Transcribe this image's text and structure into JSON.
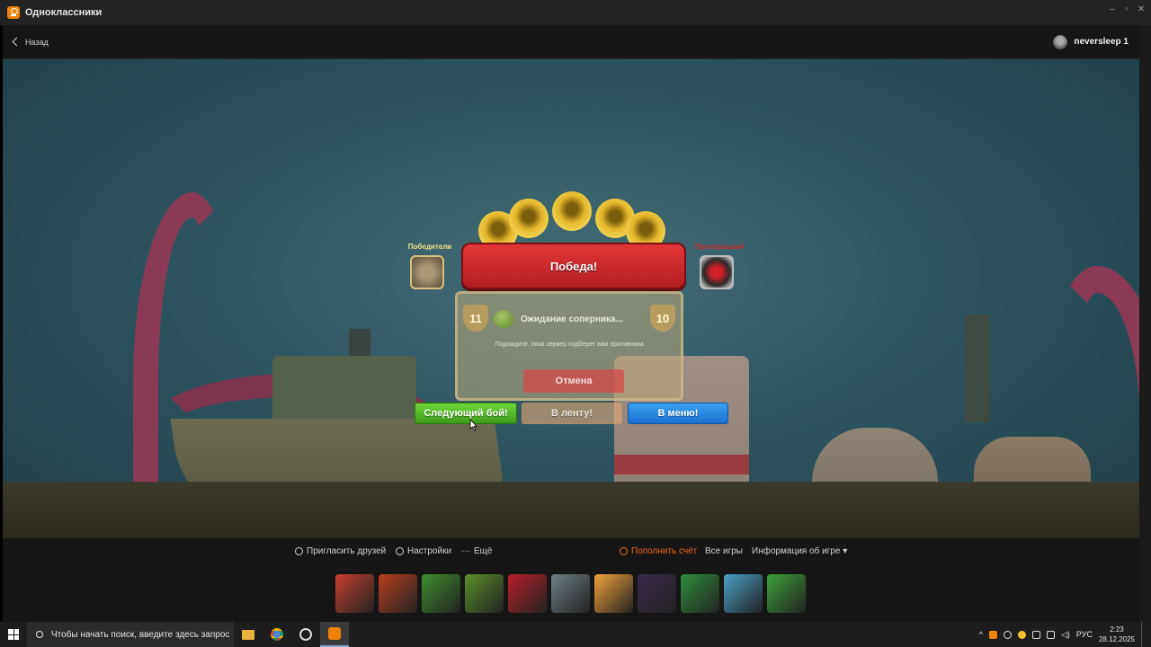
{
  "window": {
    "title": "Одноклассники"
  },
  "header": {
    "back_label": "Назад",
    "username": "neversleep 1"
  },
  "game": {
    "victory": "Победа!",
    "winners_label": "Победители",
    "losers_label": "Проигравший",
    "waiting": {
      "level_left": "11",
      "level_right": "10",
      "title": "Ожидание соперника...",
      "subtitle": "Подождите, пока сервер подберет вам противника",
      "cancel": "Отмена"
    },
    "buttons": {
      "next": "Следующий бой!",
      "feed": "В ленту!",
      "menu": "В меню!"
    }
  },
  "bottom": {
    "invite": "Пригласить друзей",
    "settings": "Настройки",
    "more": "Ещё",
    "topup": "Пополнить счёт",
    "all_games": "Все игры",
    "game_info": "Информация об игре ▾",
    "tiles": [
      {
        "name": "game-tile-1",
        "color": "#c8402f"
      },
      {
        "name": "game-tile-2",
        "color": "#b8401e"
      },
      {
        "name": "game-tile-3",
        "color": "#3f8f2e"
      },
      {
        "name": "game-tile-4",
        "color": "#5c8f2a"
      },
      {
        "name": "game-tile-5",
        "color": "#b9202a"
      },
      {
        "name": "game-tile-6",
        "color": "#6f7f86"
      },
      {
        "name": "game-tile-7",
        "color": "#f2a23a"
      },
      {
        "name": "game-tile-8",
        "color": "#3a2a4a"
      },
      {
        "name": "game-tile-9",
        "color": "#2f8f3a"
      },
      {
        "name": "game-tile-10",
        "color": "#4aa0c8"
      },
      {
        "name": "game-tile-11",
        "color": "#3ea23a"
      }
    ]
  },
  "taskbar": {
    "search_placeholder": "Чтобы начать поиск, введите здесь запрос",
    "language": "РУС",
    "time": "2:23",
    "date": "28.12.2025"
  }
}
